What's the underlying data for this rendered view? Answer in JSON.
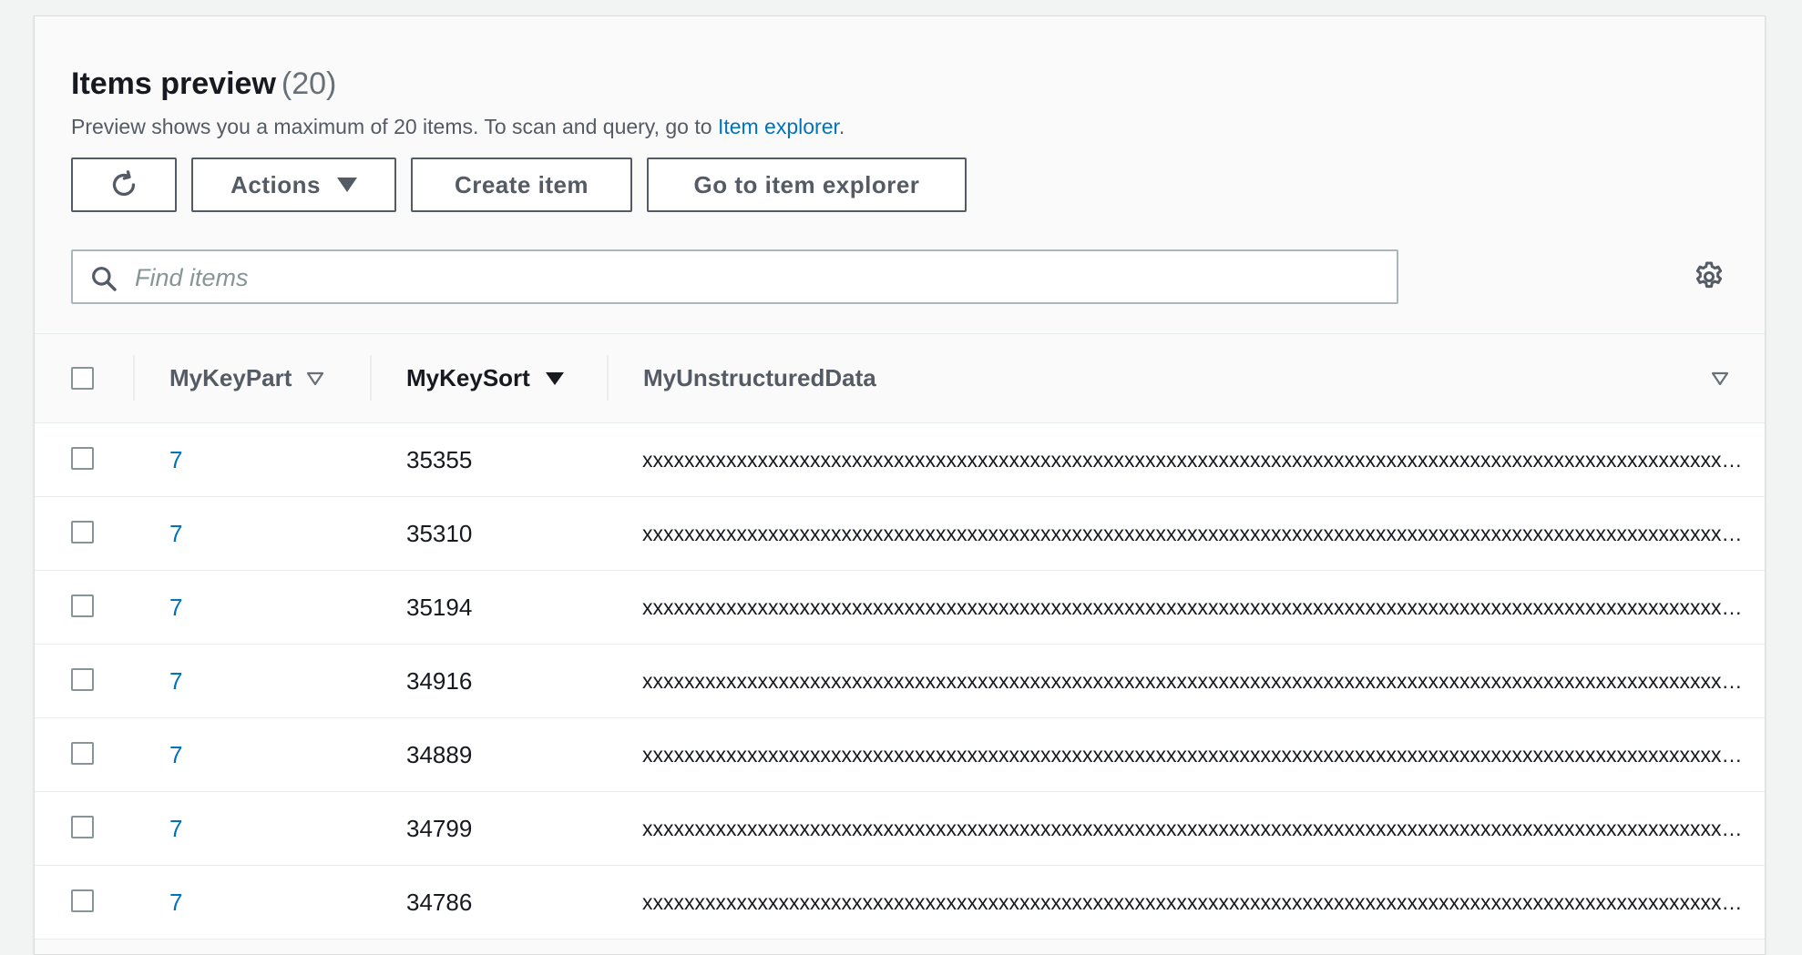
{
  "header": {
    "title": "Items preview",
    "count": "(20)",
    "description": "Preview shows you a maximum of 20 items. To scan and query, go to",
    "description_link": "Item explorer",
    "description_end": "."
  },
  "toolbar": {
    "refresh_icon": "refresh-icon",
    "actions_label": "Actions",
    "create_label": "Create item",
    "goto_label": "Go to item explorer"
  },
  "search": {
    "placeholder": "Find items",
    "value": ""
  },
  "settings_icon": "gear-icon",
  "table": {
    "columns": [
      {
        "label": "MyKeyPart",
        "sort": "none"
      },
      {
        "label": "MyKeySort",
        "sort": "descending"
      },
      {
        "label": "MyUnstructuredData",
        "sort": "none"
      }
    ],
    "rows": [
      {
        "part": "7",
        "sort": "35355",
        "data": "xxxxxxxxxxxxxxxxxxxxxxxxxxxxxxxxxxxxxxxxxxxxxxxxxxxxxxxxxxxxxxxxxxxxxxxxxxxxxxxxxxxxxxxxxxxxxxxxxxxxxxxxxxxxxxxxxxxx"
      },
      {
        "part": "7",
        "sort": "35310",
        "data": "xxxxxxxxxxxxxxxxxxxxxxxxxxxxxxxxxxxxxxxxxxxxxxxxxxxxxxxxxxxxxxxxxxxxxxxxxxxxxxxxxxxxxxxxxxxxxxxxxxxxxxxxxxxxxxxxxxxx"
      },
      {
        "part": "7",
        "sort": "35194",
        "data": "xxxxxxxxxxxxxxxxxxxxxxxxxxxxxxxxxxxxxxxxxxxxxxxxxxxxxxxxxxxxxxxxxxxxxxxxxxxxxxxxxxxxxxxxxxxxxxxxxxxxxxxxxxxxxxxxxxxx"
      },
      {
        "part": "7",
        "sort": "34916",
        "data": "xxxxxxxxxxxxxxxxxxxxxxxxxxxxxxxxxxxxxxxxxxxxxxxxxxxxxxxxxxxxxxxxxxxxxxxxxxxxxxxxxxxxxxxxxxxxxxxxxxxxxxxxxxxxxxxxxxxx"
      },
      {
        "part": "7",
        "sort": "34889",
        "data": "xxxxxxxxxxxxxxxxxxxxxxxxxxxxxxxxxxxxxxxxxxxxxxxxxxxxxxxxxxxxxxxxxxxxxxxxxxxxxxxxxxxxxxxxxxxxxxxxxxxxxxxxxxxxxxxxxxxx"
      },
      {
        "part": "7",
        "sort": "34799",
        "data": "xxxxxxxxxxxxxxxxxxxxxxxxxxxxxxxxxxxxxxxxxxxxxxxxxxxxxxxxxxxxxxxxxxxxxxxxxxxxxxxxxxxxxxxxxxxxxxxxxxxxxxxxxxxxxxxxxxxx"
      },
      {
        "part": "7",
        "sort": "34786",
        "data": "xxxxxxxxxxxxxxxxxxxxxxxxxxxxxxxxxxxxxxxxxxxxxxxxxxxxxxxxxxxxxxxxxxxxxxxxxxxxxxxxxxxxxxxxxxxxxxxxxxxxxxxxxxxxxxxxxxxx"
      }
    ]
  },
  "colors": {
    "link": "#0073bb",
    "text": "#16191f",
    "muted": "#545b64",
    "border": "#aab7b8"
  }
}
